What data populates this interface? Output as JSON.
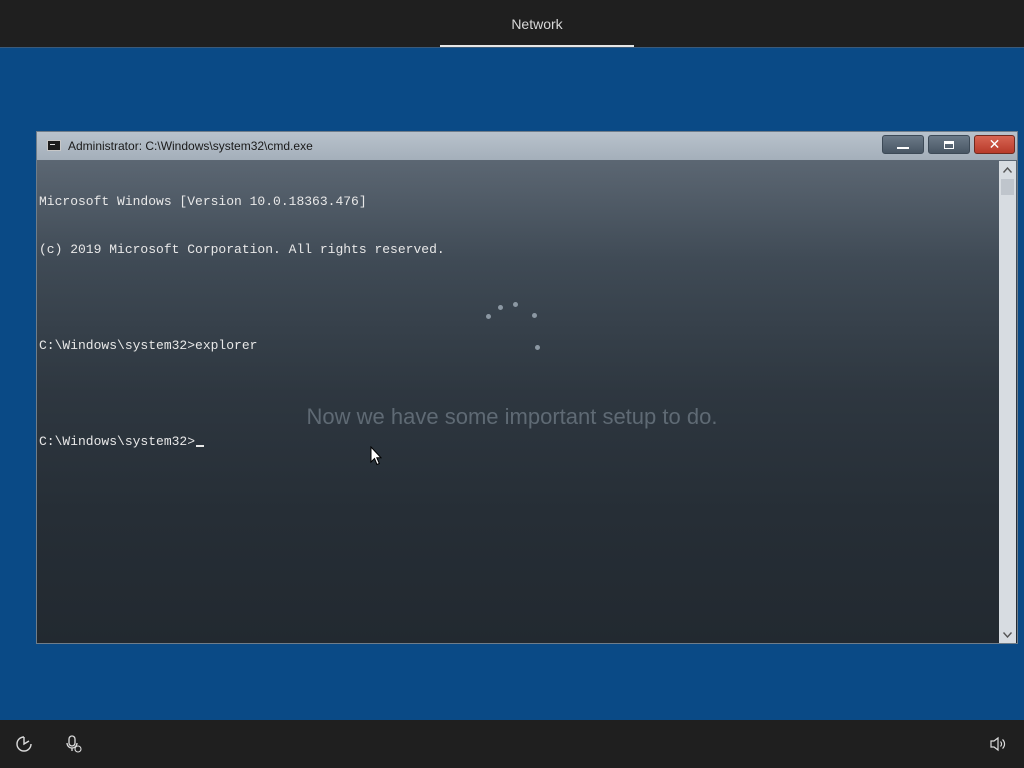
{
  "top_bar": {
    "tab_label": "Network"
  },
  "cmd": {
    "title": "Administrator: C:\\Windows\\system32\\cmd.exe",
    "lines": [
      "Microsoft Windows [Version 10.0.18363.476]",
      "(c) 2019 Microsoft Corporation. All rights reserved.",
      "",
      "C:\\Windows\\system32>explorer",
      "",
      "C:\\Windows\\system32>"
    ]
  },
  "oobe": {
    "status_text": "Now we have some important setup to do."
  },
  "bottom_bar": {
    "icons": [
      "ease-of-access-icon",
      "microphone-icon",
      "volume-icon"
    ]
  },
  "colors": {
    "desktop_blue": "#0a4a86",
    "bar_dark": "#1f1f1f",
    "close_red": "#c84a38"
  }
}
